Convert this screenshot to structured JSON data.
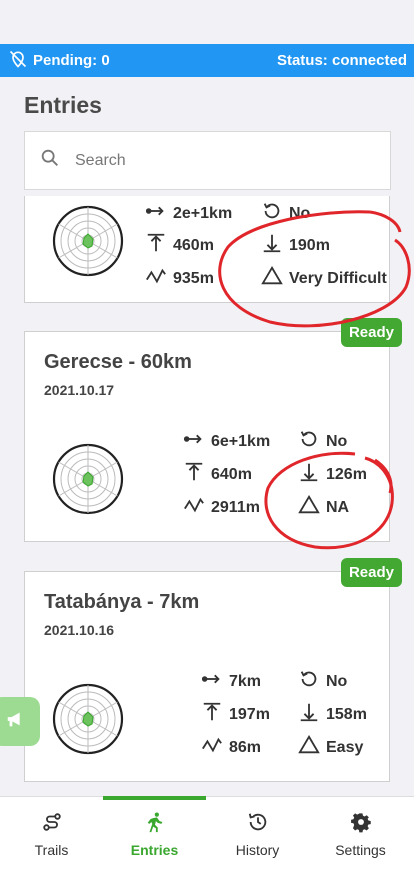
{
  "status": {
    "pending": "Pending: 0",
    "connection": "Status: connected",
    "bar_color": "#2196f3"
  },
  "page_title": "Entries",
  "search": {
    "placeholder": "Search"
  },
  "cards": [
    {
      "name": "",
      "date": "",
      "badge": "",
      "distance": "2e+1km",
      "loop": "No",
      "ascent": "460m",
      "descent": "190m",
      "elevation": "935m",
      "difficulty": "Very Difficult"
    },
    {
      "name": "Gerecse - 60km",
      "date": "2021.10.17",
      "badge": "Ready",
      "distance": "6e+1km",
      "loop": "No",
      "ascent": "640m",
      "descent": "126m",
      "elevation": "2911m",
      "difficulty": "NA"
    },
    {
      "name": "Tatabánya - 7km",
      "date": "2021.10.16",
      "badge": "Ready",
      "distance": "7km",
      "loop": "No",
      "ascent": "197m",
      "descent": "158m",
      "elevation": "86m",
      "difficulty": "Easy"
    }
  ],
  "tabs": [
    {
      "label": "Trails",
      "icon": "route-icon"
    },
    {
      "label": "Entries",
      "icon": "running-icon",
      "active": true
    },
    {
      "label": "History",
      "icon": "history-icon"
    },
    {
      "label": "Settings",
      "icon": "gear-icon"
    }
  ],
  "colors": {
    "accent": "#3aa72f",
    "badge": "#43a832",
    "fab": "#9ddb92",
    "annotation": "#e0262a"
  }
}
